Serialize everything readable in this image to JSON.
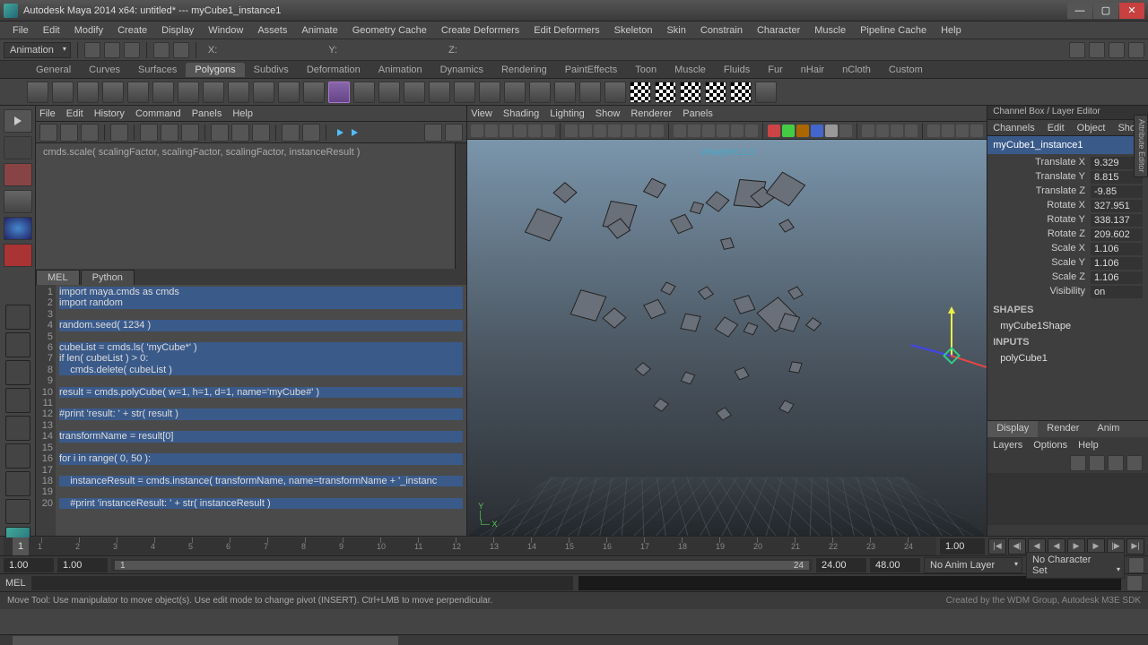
{
  "title": "Autodesk Maya 2014 x64: untitled*  ---  myCube1_instance1",
  "menus": [
    "File",
    "Edit",
    "Modify",
    "Create",
    "Display",
    "Window",
    "Assets",
    "Animate",
    "Geometry Cache",
    "Create Deformers",
    "Edit Deformers",
    "Skeleton",
    "Skin",
    "Constrain",
    "Character",
    "Muscle",
    "Pipeline Cache",
    "Help"
  ],
  "mode_dd": "Animation",
  "coords": [
    "X:",
    "Y:",
    "Z:"
  ],
  "shelf_tabs": [
    "General",
    "Curves",
    "Surfaces",
    "Polygons",
    "Subdivs",
    "Deformation",
    "Animation",
    "Dynamics",
    "Rendering",
    "PaintEffects",
    "Toon",
    "Muscle",
    "Fluids",
    "Fur",
    "nHair",
    "nCloth",
    "Custom"
  ],
  "shelf_active": "Polygons",
  "script_menu": [
    "File",
    "Edit",
    "History",
    "Command",
    "Panels",
    "Help"
  ],
  "output_text": "cmds.scale( scalingFactor, scalingFactor, scalingFactor, instanceResult )",
  "code_tabs": [
    "MEL",
    "Python"
  ],
  "code_active": "Python",
  "code_lines": [
    "import maya.cmds as cmds",
    "import random",
    "",
    "random.seed( 1234 )",
    "",
    "cubeList = cmds.ls( 'myCube*' )",
    "if len( cubeList ) > 0:",
    "    cmds.delete( cubeList )",
    "",
    "result = cmds.polyCube( w=1, h=1, d=1, name='myCube#' )",
    "",
    "#print 'result: ' + str( result )",
    "",
    "transformName = result[0]",
    "",
    "for i in range( 0, 50 ):",
    "",
    "    instanceResult = cmds.instance( transformName, name=transformName + '_instanc",
    "",
    "    #print 'instanceResult: ' + str( instanceResult )"
  ],
  "vp_menu": [
    "View",
    "Shading",
    "Lighting",
    "Show",
    "Renderer",
    "Panels"
  ],
  "vp_label": "Viewport 2.0",
  "cb_title": "Channel Box / Layer Editor",
  "cb_menu": [
    "Channels",
    "Edit",
    "Object",
    "Show"
  ],
  "cb_object": "myCube1_instance1",
  "cb_attrs": [
    {
      "l": "Translate X",
      "v": "9.329"
    },
    {
      "l": "Translate Y",
      "v": "8.815"
    },
    {
      "l": "Translate Z",
      "v": "-9.85"
    },
    {
      "l": "Rotate X",
      "v": "327.951"
    },
    {
      "l": "Rotate Y",
      "v": "338.137"
    },
    {
      "l": "Rotate Z",
      "v": "209.602"
    },
    {
      "l": "Scale X",
      "v": "1.106"
    },
    {
      "l": "Scale Y",
      "v": "1.106"
    },
    {
      "l": "Scale Z",
      "v": "1.106"
    },
    {
      "l": "Visibility",
      "v": "on"
    }
  ],
  "cb_shapes_label": "SHAPES",
  "cb_shape": "myCube1Shape",
  "cb_inputs_label": "INPUTS",
  "cb_input": "polyCube1",
  "layer_tabs": [
    "Display",
    "Render",
    "Anim"
  ],
  "layer_menu": [
    "Layers",
    "Options",
    "Help"
  ],
  "timeline": {
    "current": "1",
    "end": "1.00"
  },
  "range": {
    "start": "1.00",
    "startIn": "1.00",
    "barL": "1",
    "barR": "24",
    "endIn": "24.00",
    "end": "48.00"
  },
  "anim_layer": "No Anim Layer",
  "char_set": "No Character Set",
  "cmd_label": "MEL",
  "status_msg": "Move Tool: Use manipulator to move object(s). Use edit mode to change pivot (INSERT). Ctrl+LMB to move perpendicular.",
  "status_credit": "Created by the WDM Group, Autodesk M3E   SDK",
  "attr_tab": "Attribute Editor"
}
